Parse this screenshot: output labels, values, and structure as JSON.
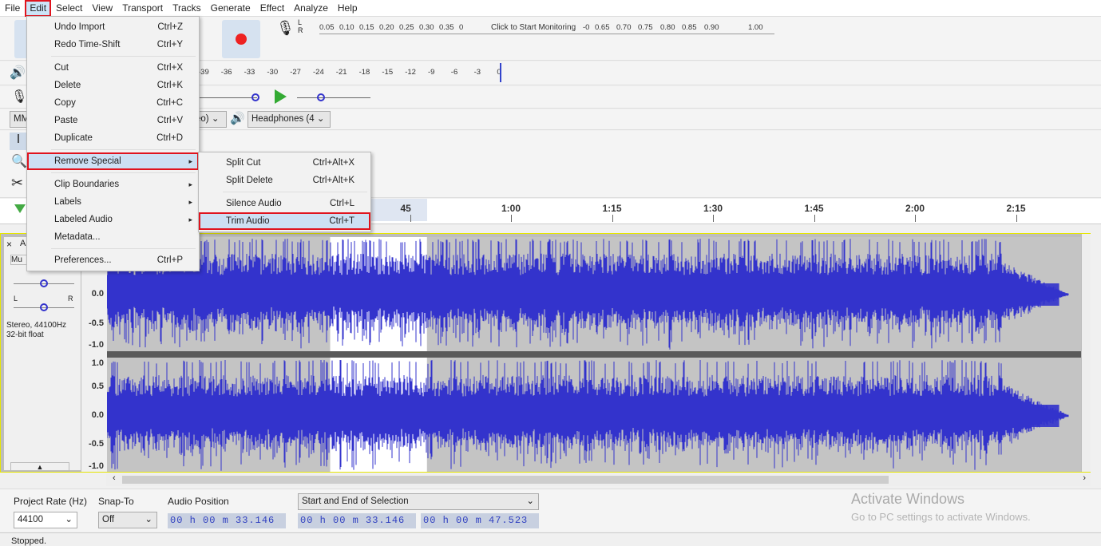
{
  "menubar": [
    "File",
    "Edit",
    "Select",
    "View",
    "Transport",
    "Tracks",
    "Generate",
    "Effect",
    "Analyze",
    "Help"
  ],
  "meter": {
    "record_scale": [
      "0.05",
      "0.10",
      "0.15",
      "0.20",
      "0.25",
      "0.30",
      "0.35",
      "0"
    ],
    "monitor_text": "Click to Start Monitoring",
    "record_scale_right": [
      "-0",
      "0.65",
      "0.70",
      "0.75",
      "0.80",
      "0.85",
      "0.90",
      "1.00"
    ],
    "lr": [
      "L",
      "R"
    ],
    "play_scale": [
      "-39",
      "-36",
      "-33",
      "-30",
      "-27",
      "-24",
      "-21",
      "-18",
      "-15",
      "-12",
      "-9",
      "-6",
      "-3",
      "0"
    ]
  },
  "devices": {
    "host": "MM",
    "channels": "eo)",
    "output": "Headphones (4"
  },
  "edit_menu": {
    "items": [
      {
        "label": "Undo Import",
        "shortcut": "Ctrl+Z"
      },
      {
        "label": "Redo Time-Shift",
        "shortcut": "Ctrl+Y",
        "sep_after": true
      },
      {
        "label": "Cut",
        "shortcut": "Ctrl+X"
      },
      {
        "label": "Delete",
        "shortcut": "Ctrl+K"
      },
      {
        "label": "Copy",
        "shortcut": "Ctrl+C"
      },
      {
        "label": "Paste",
        "shortcut": "Ctrl+V"
      },
      {
        "label": "Duplicate",
        "shortcut": "Ctrl+D",
        "sep_after": true
      },
      {
        "label": "Remove Special",
        "submenu": true,
        "highlighted": true,
        "sep_after": true
      },
      {
        "label": "Clip Boundaries",
        "submenu": true
      },
      {
        "label": "Labels",
        "submenu": true
      },
      {
        "label": "Labeled Audio",
        "submenu": true
      },
      {
        "label": "Metadata...",
        "sep_after": true
      },
      {
        "label": "Preferences...",
        "shortcut": "Ctrl+P"
      }
    ]
  },
  "remove_special_menu": {
    "items": [
      {
        "label": "Split Cut",
        "shortcut": "Ctrl+Alt+X"
      },
      {
        "label": "Split Delete",
        "shortcut": "Ctrl+Alt+K",
        "sep_after": true
      },
      {
        "label": "Silence Audio",
        "shortcut": "Ctrl+L"
      },
      {
        "label": "Trim Audio",
        "shortcut": "Ctrl+T",
        "highlighted": true
      }
    ]
  },
  "ruler": {
    "ticks": [
      "45",
      "1:00",
      "1:15",
      "1:30",
      "1:45",
      "2:00",
      "2:15"
    ],
    "tick_seconds": [
      45,
      60,
      75,
      90,
      105,
      120,
      135
    ]
  },
  "track": {
    "close": "×",
    "name_abbrev": "A",
    "mute_abbrev": "Mu",
    "pan_l": "L",
    "pan_r": "R",
    "info1": "Stereo, 44100Hz",
    "info2": "32-bit float",
    "y_labels_top": [
      "0.0",
      "-0.5",
      "-1.0"
    ],
    "y_labels_bottom": [
      "1.0",
      "0.5",
      "0.0",
      "-0.5",
      "-1.0"
    ],
    "waveform_color": "#3333cc",
    "selection_start_s": 33.146,
    "selection_end_s": 47.523,
    "audio_end_s": 142
  },
  "selbar": {
    "rate_label": "Project Rate (Hz)",
    "rate": "44100",
    "snap_label": "Snap-To",
    "snap": "Off",
    "pos_label": "Audio Position",
    "pos": "00 h 00 m 33.146 s",
    "sel_mode": "Start and End of Selection",
    "sel_start": "00 h 00 m 33.146 s",
    "sel_end": "00 h 00 m 47.523 s"
  },
  "status": "Stopped.",
  "watermark": {
    "title": "Activate Windows",
    "sub": "Go to PC settings to activate Windows."
  }
}
